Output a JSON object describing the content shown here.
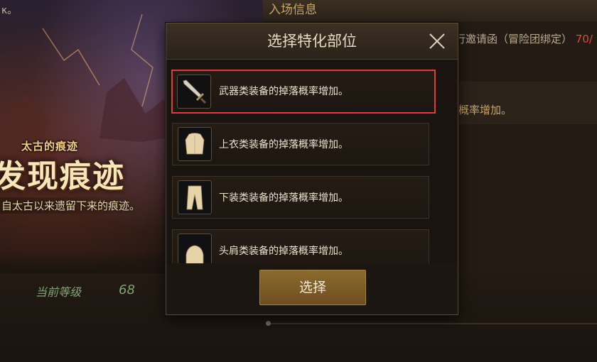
{
  "background": {
    "top_text": "κ。",
    "event": {
      "subtitle": "太古的痕迹",
      "title": "发现痕迹",
      "description": "自太古以来遗留下来的痕迹。"
    },
    "level": {
      "label": "当前等级",
      "value": "68"
    },
    "entry": {
      "header": "入场信息",
      "invite_text": "行邀请函（冒险团绑定）",
      "invite_count": "70/",
      "bonus_text": "概率增加。"
    }
  },
  "modal": {
    "title": "选择特化部位",
    "close_icon": "close-icon",
    "options": [
      {
        "label": "武器类装备的掉落概率增加。",
        "icon": "sword-icon",
        "selected": true
      },
      {
        "label": "上衣类装备的掉落概率增加。",
        "icon": "shirt-icon",
        "selected": false
      },
      {
        "label": "下装类装备的掉落概率增加。",
        "icon": "pants-icon",
        "selected": false
      },
      {
        "label": "头肩类装备的掉落概率增加。",
        "icon": "shoulder-icon",
        "selected": false
      }
    ],
    "select_button": "选择"
  },
  "colors": {
    "selection_border": "#e33a3a",
    "button_gold": "#8c6a2e",
    "level_green": "#7fa572",
    "invite_red": "#e04a3a"
  }
}
